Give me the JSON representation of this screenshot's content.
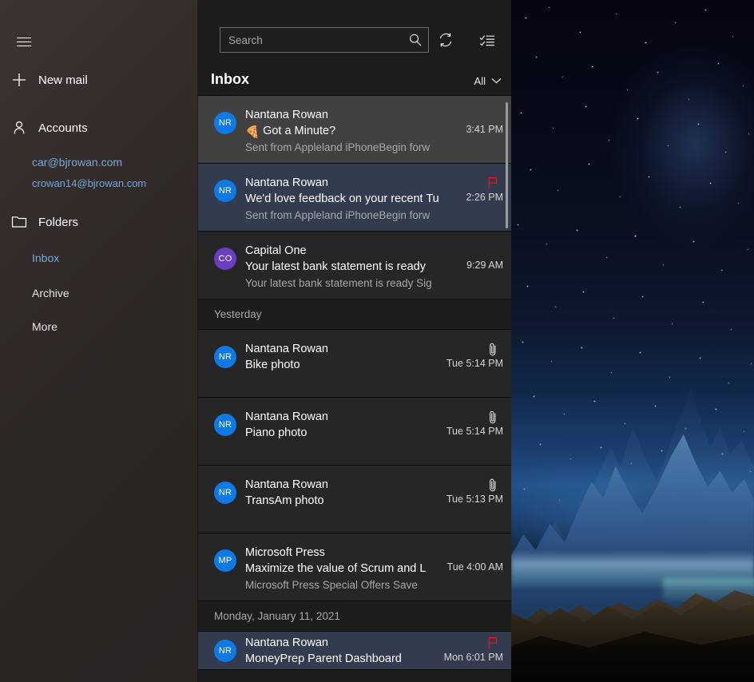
{
  "window": {
    "title": "Inbox - car@bjrowan.com"
  },
  "nav": {
    "hamburger_name": "hamburger-menu",
    "new_mail": "New mail",
    "accounts_label": "Accounts",
    "accounts": [
      {
        "label": "car@bjrowan.com",
        "selected": true
      },
      {
        "label": "crowan14@bjrowan.com",
        "selected": false
      }
    ],
    "folders_label": "Folders",
    "folders": [
      {
        "label": "Inbox",
        "selected": true
      },
      {
        "label": "Archive",
        "selected": false
      },
      {
        "label": "More",
        "selected": false
      }
    ]
  },
  "toolbar": {
    "search_placeholder": "Search",
    "search_value": "",
    "search_icon": "search-icon",
    "sync_icon": "sync-icon",
    "select_icon": "select-mode-icon"
  },
  "list_header": {
    "folder_title": "Inbox",
    "filter_label": "All",
    "filter_chevron": "chevron-down-icon"
  },
  "colors": {
    "accent_link": "#74a8dc",
    "avatar_blue": "#0f7ae5",
    "avatar_purple": "#6b3fc4",
    "flag_red": "#e81123",
    "row_normal": "#262626",
    "row_hover": "#414141",
    "row_selected": "#323c4e",
    "group_header": "#1c1c1c"
  },
  "scrollbar": {
    "name": "message-list-scrollbar"
  },
  "groups": [
    {
      "header": null,
      "messages": [
        {
          "sender": "Nantana Rowan",
          "subject": "Got a Minute?",
          "emoji": "🍕",
          "preview": "Sent from Appleland iPhoneBegin forw",
          "time": "3:41 PM",
          "avatar_initials": "NR",
          "avatar_color": "#0f7ae5",
          "state": "hovered",
          "icon": null,
          "compact": false
        },
        {
          "sender": "Nantana Rowan",
          "subject": "We'd love feedback on your recent Tu",
          "emoji": "",
          "preview": "Sent from Appleland iPhoneBegin forw",
          "time": "2:26 PM",
          "avatar_initials": "NR",
          "avatar_color": "#0f7ae5",
          "state": "selected",
          "icon": "flag-icon",
          "compact": false
        },
        {
          "sender": "Capital One",
          "subject": "Your latest bank statement is ready",
          "emoji": "",
          "preview": "Your latest bank statement is ready Sig",
          "time": "9:29 AM",
          "avatar_initials": "CO",
          "avatar_color": "#6b3fc4",
          "state": "normal",
          "icon": null,
          "compact": false
        }
      ]
    },
    {
      "header": "Yesterday",
      "messages": [
        {
          "sender": "Nantana Rowan",
          "subject": "Bike photo",
          "emoji": "",
          "preview": "",
          "time": "Tue 5:14 PM",
          "avatar_initials": "NR",
          "avatar_color": "#0f7ae5",
          "state": "normal",
          "icon": "attachment-icon",
          "compact": false
        },
        {
          "sender": "Nantana Rowan",
          "subject": "Piano photo",
          "emoji": "",
          "preview": "",
          "time": "Tue 5:14 PM",
          "avatar_initials": "NR",
          "avatar_color": "#0f7ae5",
          "state": "normal",
          "icon": "attachment-icon",
          "compact": false
        },
        {
          "sender": "Nantana Rowan",
          "subject": "TransAm photo",
          "emoji": "",
          "preview": "",
          "time": "Tue 5:13 PM",
          "avatar_initials": "NR",
          "avatar_color": "#0f7ae5",
          "state": "normal",
          "icon": "attachment-icon",
          "compact": false
        },
        {
          "sender": "Microsoft Press",
          "subject": "Maximize the value of Scrum and L",
          "emoji": "",
          "preview": "Microsoft Press Special Offers Save",
          "time": "Tue 4:00 AM",
          "avatar_initials": "MP",
          "avatar_color": "#0f7ae5",
          "state": "normal",
          "icon": null,
          "compact": false
        }
      ]
    },
    {
      "header": "Monday, January 11, 2021",
      "messages": [
        {
          "sender": "Nantana Rowan",
          "subject": "MoneyPrep Parent Dashboard",
          "emoji": "",
          "preview": "",
          "time": "Mon 6:01 PM",
          "avatar_initials": "NR",
          "avatar_color": "#0f7ae5",
          "state": "selected",
          "icon": "flag-icon",
          "compact": true
        }
      ]
    }
  ]
}
